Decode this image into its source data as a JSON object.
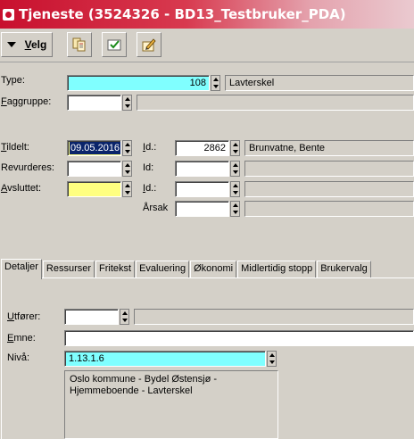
{
  "window": {
    "title": "Tjeneste (3524326 - BD13_Testbruker_PDA)"
  },
  "toolbar": {
    "velg_label": "Velg",
    "velg_underline": "V",
    "velg_rest": "elg"
  },
  "form": {
    "type": {
      "label": "Type:",
      "value": "108",
      "description": "Lavterskel"
    },
    "faggruppe": {
      "label_u": "F",
      "label_rest": "aggruppe:",
      "value": "",
      "description": ""
    },
    "tildelt": {
      "label_u": "T",
      "label_rest": "ildelt:",
      "date": "09.05.2016",
      "id_label_u": "I",
      "id_label_rest": "d.:",
      "id_value": "2862",
      "name": "Brunvatne, Bente"
    },
    "revurderes": {
      "label": "Revurderes:",
      "date": "",
      "id_label": "Id:",
      "id_value": "",
      "name": ""
    },
    "avsluttet": {
      "label_u": "A",
      "label_rest": "vsluttet:",
      "date": "",
      "id_label_u": "I",
      "id_label_rest": "d.:",
      "id_value": "",
      "name": ""
    },
    "arsak": {
      "label": "Årsak",
      "value": "",
      "description": ""
    }
  },
  "tabs": [
    {
      "label": "Detaljer",
      "active": true
    },
    {
      "label": "Ressurser"
    },
    {
      "label": "Fritekst"
    },
    {
      "label": "Evaluering"
    },
    {
      "label": "Økonomi"
    },
    {
      "label": "Midlertidig stopp"
    },
    {
      "label": "Brukervalg"
    }
  ],
  "details": {
    "utforer": {
      "label_u": "U",
      "label_rest": "tfører:",
      "value": "",
      "description": ""
    },
    "emne": {
      "label_u": "E",
      "label_rest": "mne:",
      "value": ""
    },
    "niva": {
      "label": "Nivå:",
      "value": "1.13.1.6",
      "description": "Oslo kommune - Bydel Østensjø - Hjemmeboende - Lavterskel"
    }
  },
  "colors": {
    "title_red": "#c8102e",
    "required_cyan": "#80ffff",
    "required_yellow": "#ffff80",
    "selection_blue": "#0a246a"
  }
}
